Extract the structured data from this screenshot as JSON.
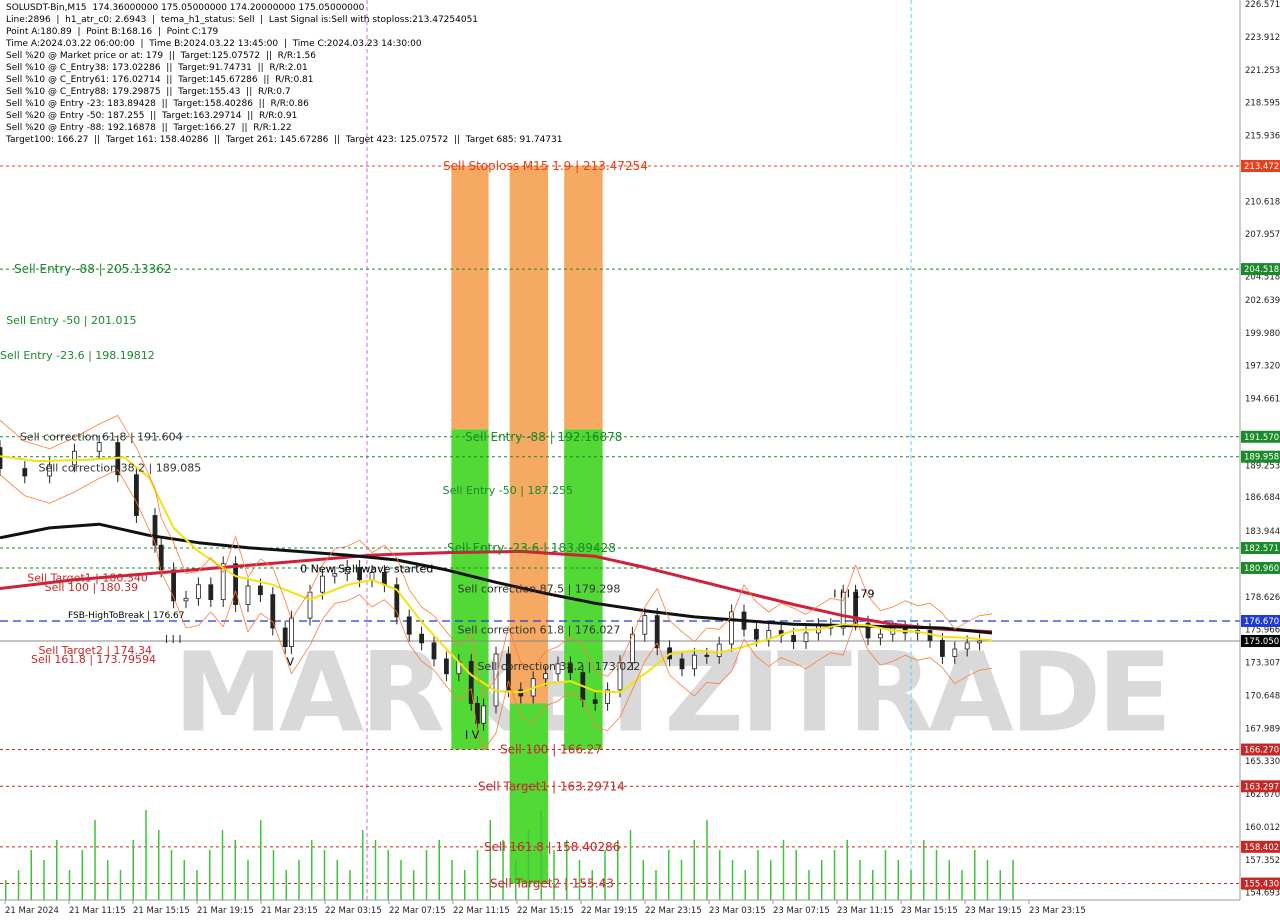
{
  "chart_data": {
    "type": "line",
    "instrument": "SOLUSDT-Bin",
    "timeframe": "M15",
    "info_lines": [
      "SOLUSDT-Bin,M15  174.36000000 175.05000000 174.20000000 175.05000000",
      "Line:2896  |  h1_atr_c0: 2.6943  |  tema_h1_status: Sell  |  Last Signal is:Sell with stoploss:213.47254051",
      "Point A:180.89  |  Point B:168.16  |  Point C:179",
      "Time A:2024.03.22 06:00:00  |  Time B:2024.03.22 13:45:00  |  Time C:2024.03.23 14:30:00",
      "Sell %20 @ Market price or at: 179  ||  Target:125.07572  ||  R/R:1.56",
      "Sell %10 @ C_Entry38: 173.02286  ||  Target:91.74731  ||  R/R:2.01",
      "Sell %10 @ C_Entry61: 176.02714  ||  Target:145.67286  ||  R/R:0.81",
      "Sell %10 @ C_Entry88: 179.29875  ||  Target:155.43  ||  R/R:0.7",
      "Sell %10 @ Entry -23: 183.89428  ||  Target:158.40286  ||  R/R:0.86",
      "Sell %20 @ Entry -50: 187.255  ||  Target:163.29714  ||  R/R:0.91",
      "Sell %20 @ Entry -88: 192.16878  ||  Target:166.27  ||  R/R:1.22",
      "Target100: 166.27  ||  Target 161: 158.40286  ||  Target 261: 145.67286  ||  Target 423: 125.07572  ||  Target 685: 91.74731"
    ],
    "y_range": [
      154.1,
      226.9
    ],
    "y_ticks": [
      "226.571",
      "223.912",
      "221.253",
      "218.595",
      "215.936",
      "213.472",
      "210.618",
      "207.957",
      "205.298",
      "204.518",
      "202.639",
      "199.980",
      "197.320",
      "194.661",
      "191.570",
      "189.958",
      "189.253",
      "186.684",
      "183.944",
      "182.571",
      "180.960",
      "178.626",
      "176.670",
      "175.966",
      "175.050",
      "173.307",
      "170.648",
      "167.989",
      "166.270",
      "165.330",
      "163.297",
      "162.670",
      "160.012",
      "158.402",
      "157.352",
      "155.430",
      "154.693"
    ],
    "x_labels": [
      "21 Mar 2024",
      "21 Mar 11:15",
      "21 Mar 15:15",
      "21 Mar 19:15",
      "21 Mar 23:15",
      "22 Mar 03:15",
      "22 Mar 07:15",
      "22 Mar 11:15",
      "22 Mar 15:15",
      "22 Mar 19:15",
      "22 Mar 23:15",
      "23 Mar 03:15",
      "23 Mar 07:15",
      "23 Mar 11:15",
      "23 Mar 15:15",
      "23 Mar 19:15",
      "23 Mar 23:15"
    ],
    "levels": [
      {
        "value": 213.47254,
        "color": "#e8401c",
        "badge": "213.472",
        "label": "Sell Stoploss M15 1.9 | 213.47254",
        "label_color": "#e8401c"
      },
      {
        "value": 205.13362,
        "color": "#1a8a2a",
        "badge": "204.518",
        "label": "Sell Entry -88 | 205.13362",
        "label_color": "#1a8a2a"
      },
      {
        "value": 191.57,
        "color": "#1a8a2a",
        "badge": "191.570",
        "label": "Sell Entry -88 | 192.16878",
        "label_color": "#1a8a2a"
      },
      {
        "value": 189.958,
        "color": "#1a8a2a",
        "badge": "189.958",
        "label": "",
        "label_color": "#1a8a2a"
      },
      {
        "value": 182.571,
        "color": "#1a8a2a",
        "badge": "182.571",
        "label": "Sell Entry -23.6 | 183.89428",
        "label_color": "#1a8a2a"
      },
      {
        "value": 180.96,
        "color": "#1a8a2a",
        "badge": "180.960",
        "label": "",
        "label_color": "#1a8a2a"
      },
      {
        "value": 166.27,
        "color": "#c62828",
        "badge": "166.270",
        "label": "Sell 100 | 166.27",
        "label_color": "#c62828"
      },
      {
        "value": 163.297,
        "color": "#c62828",
        "badge": "163.297",
        "label": "Sell Target1 | 163.29714",
        "label_color": "#c62828"
      },
      {
        "value": 158.402,
        "color": "#c62828",
        "badge": "158.402",
        "label": "Sell 161.8 | 158.40286",
        "label_color": "#c62828"
      },
      {
        "value": 155.43,
        "color": "#c62828",
        "badge": "155.430",
        "label": "Sell Target2 | 155.43",
        "label_color": "#c62828"
      }
    ],
    "fsb_level": {
      "value": 176.67,
      "badge": "176.670",
      "label": "FSB-HighToBreak | 176.67"
    },
    "price_level": {
      "value": 175.05,
      "badge": "175.050"
    },
    "text_annotations": [
      {
        "t": "Sell Entry -50 | 201.015",
        "x": 0.005,
        "y": 201.015,
        "c": "#1a8a2a"
      },
      {
        "t": "Sell Entry -23.6 | 198.19812",
        "x": 0.0,
        "y": 198.19812,
        "c": "#1a8a2a"
      },
      {
        "t": "Sell Entry -50 | 187.255",
        "x": 0.357,
        "y": 187.255,
        "c": "#1a8a2a"
      },
      {
        "t": "Sell correction 61.8 | 191.604",
        "x": 0.016,
        "y": 191.604,
        "c": "#333"
      },
      {
        "t": "Sell correction 38.2 | 189.085",
        "x": 0.031,
        "y": 189.085,
        "c": "#333"
      },
      {
        "t": "Sell Target1 | 180.340",
        "x": 0.022,
        "y": 180.2,
        "c": "#c62828"
      },
      {
        "t": "Sell 100 | 180.39",
        "x": 0.036,
        "y": 179.4,
        "c": "#c62828"
      },
      {
        "t": "0 New Sell wave started",
        "x": 0.242,
        "y": 180.9,
        "c": "#000"
      },
      {
        "t": "Sell correction 87.5 | 179.298",
        "x": 0.369,
        "y": 179.3,
        "c": "#333"
      },
      {
        "t": "Sell correction 61.8 | 176.027",
        "x": 0.369,
        "y": 176.0,
        "c": "#333"
      },
      {
        "t": "Sell correction 38.2 | 173.022",
        "x": 0.385,
        "y": 173.02,
        "c": "#333"
      },
      {
        "t": "Sell Target2 | 174.34",
        "x": 0.031,
        "y": 174.34,
        "c": "#c62828"
      },
      {
        "t": "Sell 161.8 | 173.79594",
        "x": 0.025,
        "y": 173.6,
        "c": "#c62828"
      },
      {
        "t": "I I I",
        "x": 0.133,
        "y": 175.2,
        "c": "#333"
      },
      {
        "t": "V",
        "x": 0.231,
        "y": 173.4,
        "c": "#000"
      },
      {
        "t": "I V",
        "x": 0.375,
        "y": 167.5,
        "c": "#000"
      },
      {
        "t": "I I I 179",
        "x": 0.672,
        "y": 178.9,
        "c": "#000"
      }
    ],
    "ma_red": [
      [
        0.0,
        179.3
      ],
      [
        0.06,
        180.0
      ],
      [
        0.12,
        180.5
      ],
      [
        0.18,
        181.0
      ],
      [
        0.24,
        181.5
      ],
      [
        0.3,
        182.0
      ],
      [
        0.36,
        182.2
      ],
      [
        0.42,
        182.3
      ],
      [
        0.48,
        181.9
      ],
      [
        0.52,
        181.0
      ],
      [
        0.56,
        180.0
      ],
      [
        0.6,
        179.0
      ],
      [
        0.64,
        178.0
      ],
      [
        0.68,
        177.1
      ],
      [
        0.72,
        176.4
      ],
      [
        0.76,
        176.0
      ],
      [
        0.8,
        175.8
      ]
    ],
    "ma_black": [
      [
        0.0,
        183.4
      ],
      [
        0.04,
        184.2
      ],
      [
        0.08,
        184.5
      ],
      [
        0.12,
        183.6
      ],
      [
        0.16,
        183.0
      ],
      [
        0.2,
        182.6
      ],
      [
        0.24,
        182.3
      ],
      [
        0.28,
        182.0
      ],
      [
        0.32,
        181.6
      ],
      [
        0.36,
        180.8
      ],
      [
        0.4,
        179.8
      ],
      [
        0.44,
        178.9
      ],
      [
        0.48,
        178.1
      ],
      [
        0.52,
        177.5
      ],
      [
        0.56,
        177.0
      ],
      [
        0.6,
        176.7
      ],
      [
        0.64,
        176.4
      ],
      [
        0.68,
        176.3
      ],
      [
        0.72,
        176.2
      ],
      [
        0.76,
        176.1
      ],
      [
        0.8,
        175.7
      ]
    ],
    "ma_yellow": [
      [
        0.0,
        190.0
      ],
      [
        0.03,
        189.6
      ],
      [
        0.07,
        189.7
      ],
      [
        0.1,
        189.9
      ],
      [
        0.12,
        188.3
      ],
      [
        0.14,
        184.2
      ],
      [
        0.16,
        182.3
      ],
      [
        0.19,
        180.3
      ],
      [
        0.22,
        179.6
      ],
      [
        0.25,
        178.4
      ],
      [
        0.28,
        179.6
      ],
      [
        0.3,
        180.0
      ],
      [
        0.32,
        179.2
      ],
      [
        0.34,
        176.6
      ],
      [
        0.36,
        174.4
      ],
      [
        0.38,
        172.3
      ],
      [
        0.4,
        171.0
      ],
      [
        0.42,
        170.9
      ],
      [
        0.44,
        171.6
      ],
      [
        0.46,
        171.8
      ],
      [
        0.48,
        171.0
      ],
      [
        0.5,
        170.9
      ],
      [
        0.52,
        172.4
      ],
      [
        0.54,
        174.0
      ],
      [
        0.56,
        174.3
      ],
      [
        0.58,
        174.1
      ],
      [
        0.6,
        174.6
      ],
      [
        0.62,
        175.2
      ],
      [
        0.64,
        175.9
      ],
      [
        0.66,
        176.0
      ],
      [
        0.68,
        176.4
      ],
      [
        0.7,
        176.3
      ],
      [
        0.72,
        175.9
      ],
      [
        0.74,
        175.8
      ],
      [
        0.76,
        175.4
      ],
      [
        0.78,
        175.3
      ],
      [
        0.8,
        175.1
      ]
    ],
    "price": [
      [
        0.0,
        190.7
      ],
      [
        0.02,
        189.0
      ],
      [
        0.04,
        188.4
      ],
      [
        0.06,
        189.3
      ],
      [
        0.08,
        190.4
      ],
      [
        0.095,
        191.1
      ],
      [
        0.11,
        188.5
      ],
      [
        0.125,
        185.2
      ],
      [
        0.13,
        182.8
      ],
      [
        0.14,
        180.8
      ],
      [
        0.15,
        178.3
      ],
      [
        0.16,
        178.5
      ],
      [
        0.17,
        179.6
      ],
      [
        0.18,
        178.4
      ],
      [
        0.19,
        181.3
      ],
      [
        0.2,
        178.0
      ],
      [
        0.21,
        179.5
      ],
      [
        0.22,
        178.8
      ],
      [
        0.23,
        176.1
      ],
      [
        0.235,
        174.6
      ],
      [
        0.25,
        176.9
      ],
      [
        0.26,
        179.0
      ],
      [
        0.27,
        180.3
      ],
      [
        0.28,
        180.5
      ],
      [
        0.29,
        181.0
      ],
      [
        0.3,
        180.0
      ],
      [
        0.31,
        180.6
      ],
      [
        0.32,
        179.6
      ],
      [
        0.33,
        177.0
      ],
      [
        0.34,
        175.6
      ],
      [
        0.35,
        174.9
      ],
      [
        0.36,
        173.6
      ],
      [
        0.37,
        172.4
      ],
      [
        0.38,
        173.4
      ],
      [
        0.385,
        170.0
      ],
      [
        0.39,
        168.4
      ],
      [
        0.4,
        169.8
      ],
      [
        0.41,
        174.0
      ],
      [
        0.42,
        171.1
      ],
      [
        0.43,
        170.6
      ],
      [
        0.44,
        172.0
      ],
      [
        0.45,
        172.4
      ],
      [
        0.46,
        173.2
      ],
      [
        0.47,
        172.5
      ],
      [
        0.48,
        170.3
      ],
      [
        0.49,
        170.0
      ],
      [
        0.5,
        171.1
      ],
      [
        0.51,
        173.3
      ],
      [
        0.52,
        175.6
      ],
      [
        0.53,
        177.1
      ],
      [
        0.54,
        174.5
      ],
      [
        0.55,
        173.6
      ],
      [
        0.56,
        172.8
      ],
      [
        0.57,
        173.9
      ],
      [
        0.58,
        173.8
      ],
      [
        0.59,
        174.8
      ],
      [
        0.6,
        177.4
      ],
      [
        0.61,
        176.0
      ],
      [
        0.62,
        175.2
      ],
      [
        0.63,
        175.9
      ],
      [
        0.64,
        175.5
      ],
      [
        0.65,
        175.0
      ],
      [
        0.66,
        175.7
      ],
      [
        0.67,
        176.3
      ],
      [
        0.68,
        176.1
      ],
      [
        0.69,
        179.0
      ],
      [
        0.7,
        176.5
      ],
      [
        0.71,
        175.3
      ],
      [
        0.72,
        175.6
      ],
      [
        0.73,
        176.1
      ],
      [
        0.74,
        175.7
      ],
      [
        0.75,
        175.9
      ],
      [
        0.76,
        175.1
      ],
      [
        0.77,
        173.8
      ],
      [
        0.78,
        174.4
      ],
      [
        0.79,
        174.9
      ],
      [
        0.8,
        175.05
      ]
    ],
    "volume": [
      2,
      3,
      5,
      4,
      6,
      3,
      5,
      8,
      4,
      3,
      6,
      9,
      7,
      5,
      4,
      3,
      5,
      7,
      6,
      4,
      8,
      5,
      3,
      4,
      6,
      5,
      4,
      3,
      7,
      6,
      5,
      4,
      3,
      5,
      6,
      4,
      3,
      5,
      8,
      6,
      4,
      7,
      9,
      5,
      6,
      4,
      3,
      5,
      6,
      7,
      4,
      3,
      5,
      4,
      6,
      8,
      5,
      4,
      3,
      5,
      4,
      6,
      5,
      3,
      4,
      5,
      6,
      4,
      3,
      5,
      4,
      3,
      6,
      5,
      4,
      3,
      5,
      4,
      3,
      4
    ],
    "columns": [
      {
        "x0": 0.364,
        "x1": 0.394,
        "top": 213.47,
        "split": 192.17,
        "bottom": 166.27,
        "topColor": "#f5a962",
        "botColor": "#52d936"
      },
      {
        "x0": 0.411,
        "x1": 0.442,
        "top": 213.47,
        "split": null,
        "bottom": 155.43,
        "topColor": "#f5a962",
        "botColor": "#52d936"
      },
      {
        "x0": 0.455,
        "x1": 0.486,
        "top": 213.47,
        "split": 192.17,
        "bottom": 166.27,
        "topColor": "#f5a962",
        "botColor": "#52d936"
      }
    ],
    "watermark": "MARKETZITRADE"
  }
}
